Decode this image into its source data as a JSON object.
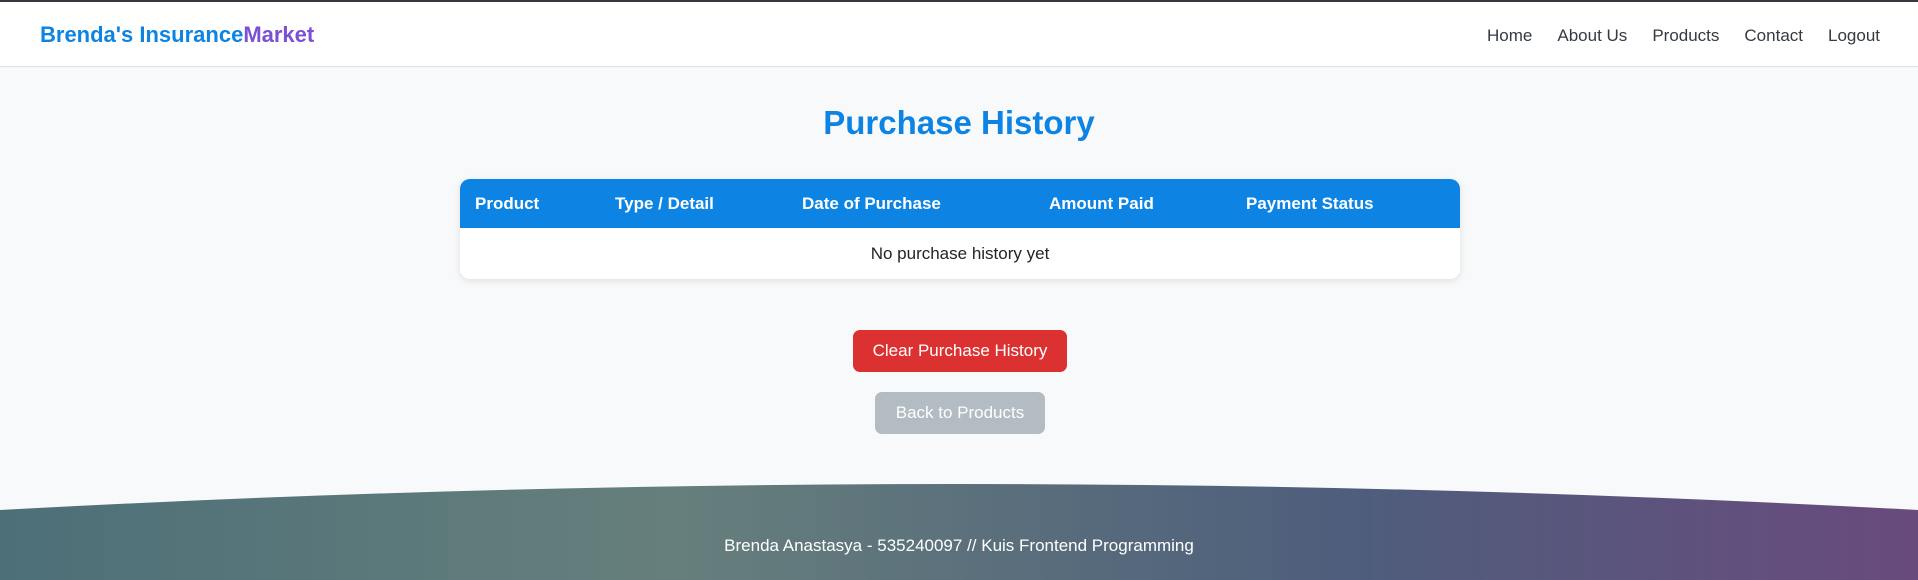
{
  "navbar": {
    "brand_part1": "Brenda's Insurance",
    "brand_part2": "Market",
    "links": [
      "Home",
      "About Us",
      "Products",
      "Contact",
      "Logout"
    ]
  },
  "page": {
    "title": "Purchase History"
  },
  "table": {
    "headers": [
      "Product",
      "Type / Detail",
      "Date of Purchase",
      "Amount Paid",
      "Payment Status"
    ],
    "empty_message": "No purchase history yet"
  },
  "buttons": {
    "clear_label": "Clear Purchase History",
    "back_label": "Back to Products"
  },
  "footer": {
    "text": "Brenda Anastasya - 535240097 // Kuis Frontend Programming"
  },
  "colors": {
    "primary": "#0d84e3",
    "brand_accent": "#7b4fd6",
    "danger": "#dc3131",
    "secondary_disabled": "#b3bcc2",
    "footer_gradient": [
      "#4d6f78",
      "#667f7c",
      "#4e5e7c",
      "#694a7d"
    ]
  }
}
